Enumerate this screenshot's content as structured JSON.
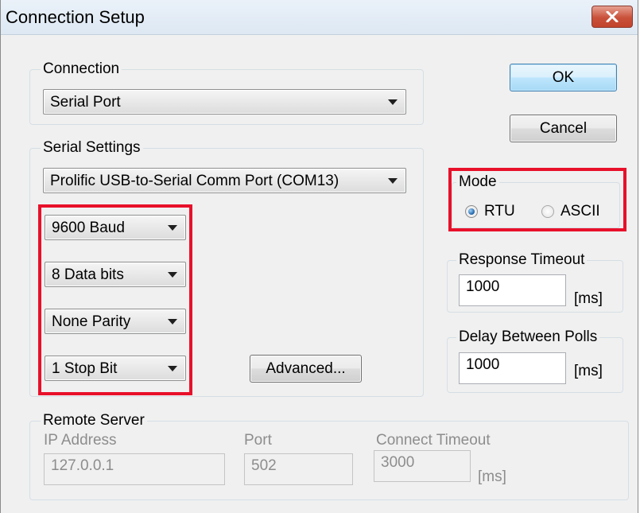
{
  "window": {
    "title": "Connection Setup"
  },
  "buttons": {
    "ok_label": "OK",
    "cancel_label": "Cancel",
    "advanced_label": "Advanced..."
  },
  "connection": {
    "group_label": "Connection",
    "selected": "Serial Port"
  },
  "serial_settings": {
    "group_label": "Serial Settings",
    "port": "Prolific USB-to-Serial Comm Port (COM13)",
    "baud": "9600 Baud",
    "data_bits": "8 Data bits",
    "parity": "None Parity",
    "stop_bits": "1 Stop Bit"
  },
  "mode": {
    "group_label": "Mode",
    "options": [
      {
        "label": "RTU",
        "checked": true
      },
      {
        "label": "ASCII",
        "checked": false
      }
    ]
  },
  "response_timeout": {
    "group_label": "Response Timeout",
    "value": "1000",
    "unit": "[ms]"
  },
  "delay_between_polls": {
    "group_label": "Delay Between Polls",
    "value": "1000",
    "unit": "[ms]"
  },
  "remote_server": {
    "group_label": "Remote Server",
    "ip_label": "IP Address",
    "ip_value": "127.0.0.1",
    "port_label": "Port",
    "port_value": "502",
    "timeout_label": "Connect Timeout",
    "timeout_value": "3000",
    "timeout_unit": "[ms]"
  },
  "colors": {
    "highlight": "#e8102a",
    "window_bg": "#f0f0f0",
    "close_button": "#c9513a"
  },
  "icons": {
    "close": "close-icon"
  }
}
